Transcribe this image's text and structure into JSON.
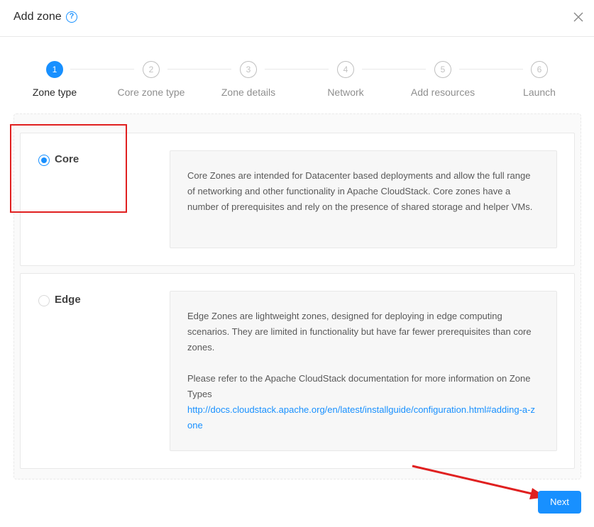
{
  "dialog": {
    "title": "Add zone",
    "help_icon": "question-circle-icon",
    "close_icon": "close-icon"
  },
  "steps": [
    {
      "number": "1",
      "label": "Zone type",
      "status": "active"
    },
    {
      "number": "2",
      "label": "Core zone type",
      "status": "wait"
    },
    {
      "number": "3",
      "label": "Zone details",
      "status": "wait"
    },
    {
      "number": "4",
      "label": "Network",
      "status": "wait"
    },
    {
      "number": "5",
      "label": "Add resources",
      "status": "wait"
    },
    {
      "number": "6",
      "label": "Launch",
      "status": "wait"
    }
  ],
  "options": [
    {
      "label": "Core",
      "checked": true,
      "description": "Core Zones are intended for Datacenter based deployments and allow the full range of networking and other functionality in Apache CloudStack. Core zones have a number of prerequisites and rely on the presence of shared storage and helper VMs."
    },
    {
      "label": "Edge",
      "checked": false,
      "description": "Edge Zones are lightweight zones, designed for deploying in edge computing scenarios. They are limited in functionality but have far fewer prerequisites than core zones.",
      "docs_text": "Please refer to the Apache CloudStack documentation for more information on Zone Types",
      "docs_link": "http://docs.cloudstack.apache.org/en/latest/installguide/configuration.html#adding-a-zone"
    }
  ],
  "footer": {
    "next_label": "Next"
  },
  "colors": {
    "primary": "#1890ff",
    "annotation": "#e02020"
  }
}
